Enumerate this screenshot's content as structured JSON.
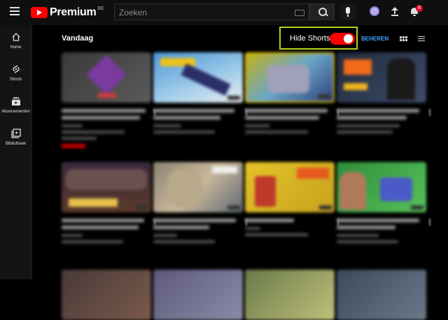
{
  "header": {
    "brand": "Premium",
    "region": "BE",
    "search_placeholder": "Zoeken",
    "notification_count": "8"
  },
  "sidebar": {
    "items": [
      {
        "label": "Home",
        "icon": "home-icon"
      },
      {
        "label": "Shorts",
        "icon": "shorts-icon"
      },
      {
        "label": "Abonnementen",
        "icon": "subscriptions-icon"
      },
      {
        "label": "Bibliotheek",
        "icon": "library-icon"
      }
    ]
  },
  "feed": {
    "title": "Vandaag",
    "hide_shorts_label": "Hide Shorts",
    "hide_shorts_on": true,
    "manage_label": "BEHEREN"
  },
  "colors": {
    "brand_red": "#ff0000",
    "highlight": "#b7d21c",
    "link_blue": "#3ea6ff"
  }
}
